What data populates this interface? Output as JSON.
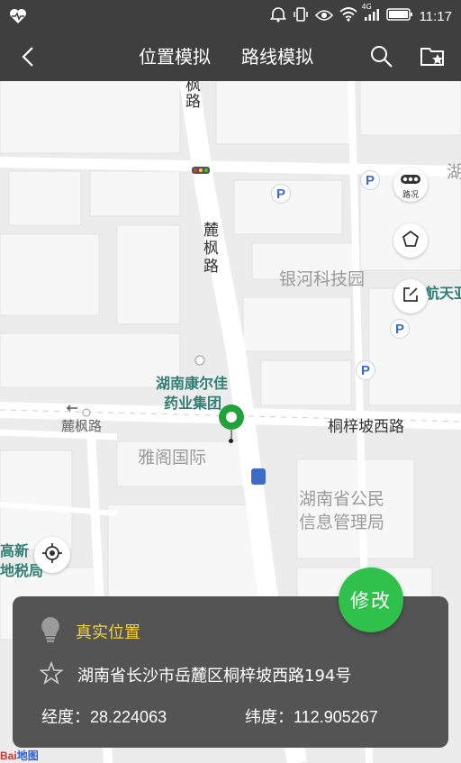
{
  "status_bar": {
    "time": "11:17",
    "network_label": "4G"
  },
  "app_bar": {
    "tab_location": "位置模拟",
    "tab_route": "路线模拟"
  },
  "map": {
    "labels": {
      "road_top": "枫路",
      "road_vertical": "麓枫路",
      "road_left": "麓枫路",
      "road_right": "桐梓坡西路",
      "yinhe": "银河科技园",
      "kangerjia_1": "湖南康尔佳",
      "kangerjia_2": "药业集团",
      "yage": "雅阁国际",
      "gongmin_1": "湖南省公民",
      "gongmin_2": "信息管理局",
      "gaoxin_1": "高新",
      "gaoxin_2": "地税局",
      "hangtian": "航天亚",
      "edge_hu": "湖"
    },
    "traffic_button_label": "路况",
    "parking_symbol": "P"
  },
  "fab_label": "修改",
  "info_panel": {
    "title": "真实位置",
    "address": "湖南省长沙市岳麓区桐梓坡西路194号",
    "latitude_label": "经度：28.224063",
    "longitude_label": "纬度：112.905267"
  },
  "logo": {
    "part1": "Bai",
    "part2": "地图"
  },
  "icons": {
    "status_left": "heart-pulse-icon",
    "back": "back-arrow-icon",
    "search": "search-icon",
    "folder_star": "folder-star-icon",
    "traffic": "traffic-icon",
    "pentagon": "pentagon-icon",
    "edit": "edit-icon",
    "locate": "locate-icon",
    "bulb": "lightbulb-icon",
    "star": "star-outline-icon"
  },
  "colors": {
    "bar": "#3f3f3f",
    "accent_green": "#2fc14c",
    "title_yellow": "#f1d33b",
    "map_green_text": "#2f7f73"
  }
}
